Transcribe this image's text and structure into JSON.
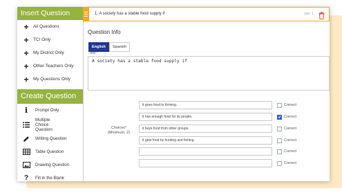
{
  "sidebar": {
    "insert_title": "Insert Question",
    "insert_items": [
      {
        "label": "All Questions"
      },
      {
        "label": "TCI Only"
      },
      {
        "label": "My District Only"
      },
      {
        "label": "Other Teachers Only"
      },
      {
        "label": "My Questions Only"
      }
    ],
    "create_title": "Create Question",
    "create_items": [
      {
        "label": "Prompt Only",
        "icon": "info-icon"
      },
      {
        "label": "Multiple Choice Question",
        "icon": "list-icon"
      },
      {
        "label": "Writing Question",
        "icon": "pencil-icon"
      },
      {
        "label": "Table Question",
        "icon": "table-icon"
      },
      {
        "label": "Drawing Question",
        "icon": "image-icon"
      },
      {
        "label": "Fill in the Blank",
        "icon": "question-icon"
      }
    ]
  },
  "question": {
    "title": "1. A society has a stable food supply if",
    "points": "pts: 1",
    "section_title": "Question Info",
    "languages": [
      "English",
      "Spanish"
    ],
    "text_label": "Text *",
    "text_value": "A society has a stable food supply if",
    "choices_label": "Choices*",
    "choices_sublabel": "(Minimum: 2)",
    "correct_label": "Correct",
    "choices": [
      {
        "text": "it goes food to thriving.",
        "correct": false
      },
      {
        "text": "it has enough food for its people.",
        "correct": true
      },
      {
        "text": "it buys food from other groups.",
        "correct": false
      },
      {
        "text": "it gets food by hunting and fishing.",
        "correct": false
      },
      {
        "text": "",
        "correct": false
      },
      {
        "text": "",
        "correct": false
      }
    ]
  },
  "colors": {
    "sidebar_header": "#95b33f",
    "accent_orange": "#f6a623",
    "language_active": "#1f3a93",
    "checkbox_checked": "#2a5bd7",
    "backdrop": "#fde9c4"
  }
}
